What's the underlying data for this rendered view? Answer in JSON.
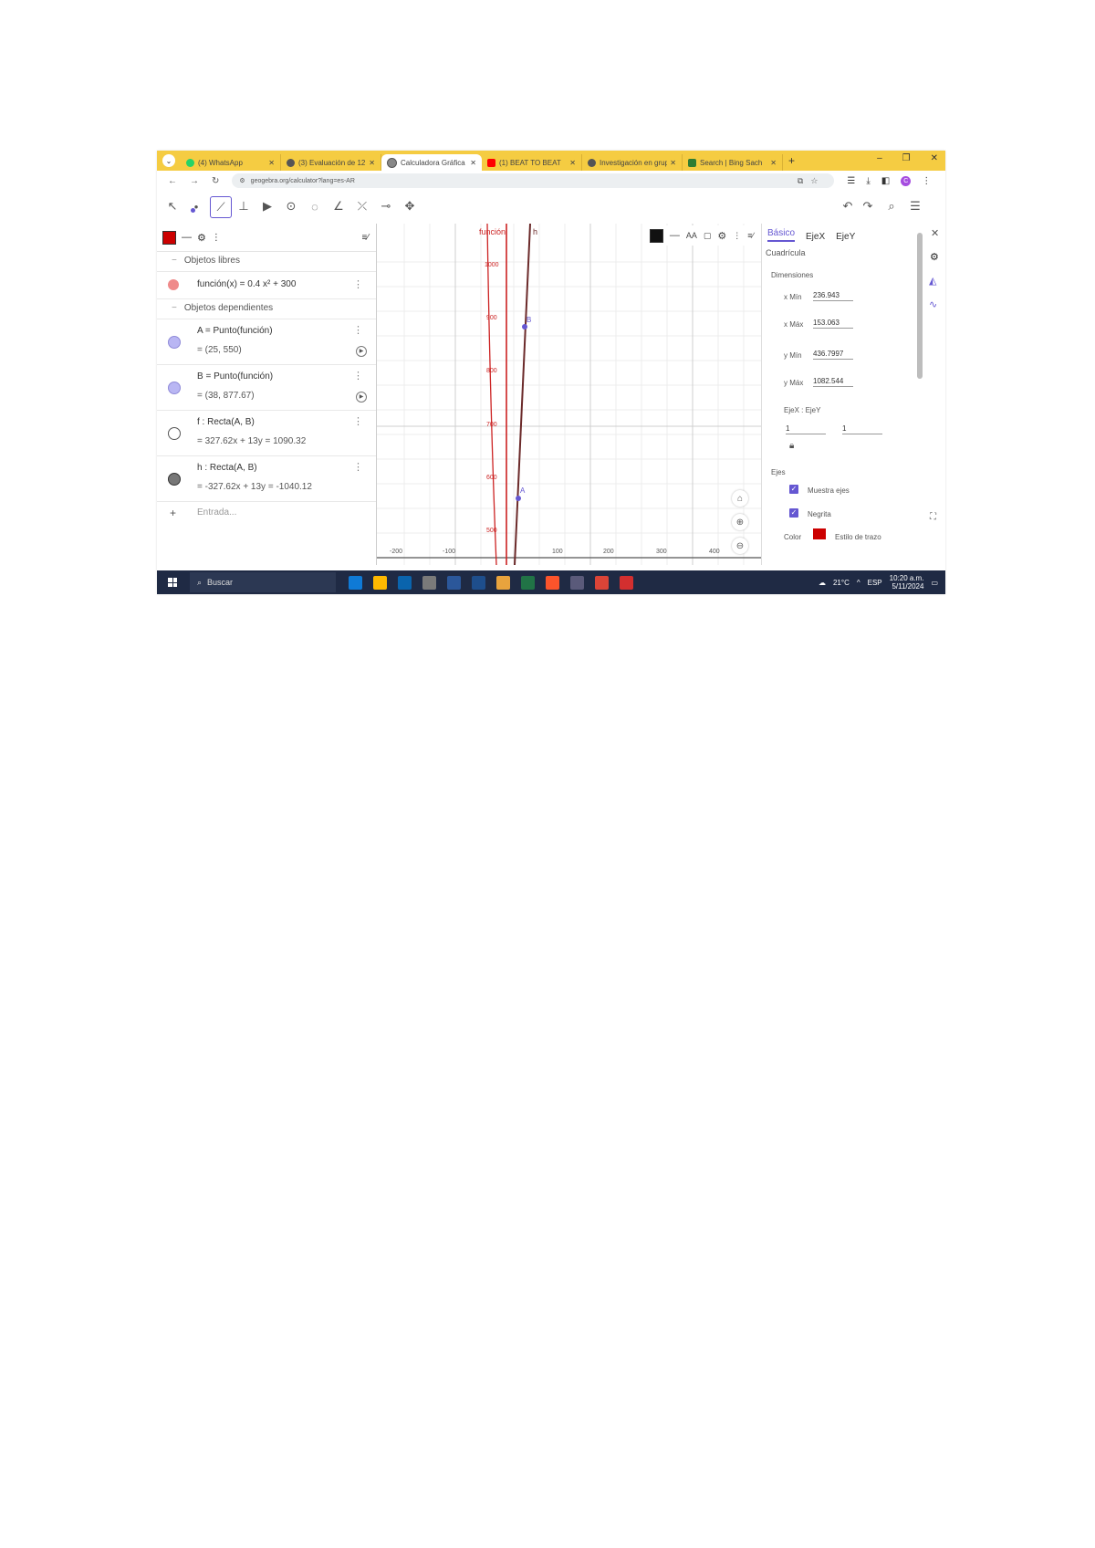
{
  "browser": {
    "tabs": [
      {
        "title": "(4) WhatsApp",
        "color": "#25d366"
      },
      {
        "title": "(3) Evaluación de 12",
        "color": "#555555"
      },
      {
        "title": "Calculadora Gráfica",
        "color": "#555555",
        "active": true
      },
      {
        "title": "(1) BEAT TO BEAT",
        "color": "#ff0000"
      },
      {
        "title": "Investigación en grupo",
        "color": "#555555"
      },
      {
        "title": "Search | Bing Sach",
        "color": "#2f7d32"
      }
    ],
    "new_tab": "+",
    "url": "geogebra.org/calculator?lang=es-AR",
    "window_controls": [
      "–",
      "❐",
      "✕"
    ],
    "profile_initial": "C"
  },
  "algebra": {
    "free_header": "Objetos libres",
    "dependent_header": "Objetos dependientes",
    "function_def": "función(x) = 0.4 x² + 300",
    "items": [
      {
        "def": "A = Punto(función)",
        "val": "= (25, 550)",
        "color": "#b9b6f3"
      },
      {
        "def": "B = Punto(función)",
        "val": "= (38, 877.67)",
        "color": "#b9b6f3"
      },
      {
        "def": "f : Recta(A, B)",
        "val": "= 327.62x + 13y = 1090.32",
        "color": "#ffffff"
      },
      {
        "def": "h : Recta(A, B)",
        "val": "= -327.62x + 13y = -1040.12",
        "color": "#777777"
      }
    ],
    "input_placeholder": "Entrada...",
    "function_color": "#ef8a8a"
  },
  "graph": {
    "label_function": "función",
    "label_h": "h",
    "point_a": "A",
    "point_b": "B",
    "y_ticks": [
      "1000",
      "900",
      "800",
      "700",
      "600",
      "500"
    ],
    "x_ticks": [
      "-200",
      "-100",
      "100",
      "200",
      "300",
      "400"
    ],
    "font_size_label": "AA"
  },
  "properties": {
    "tabs": [
      "Básico",
      "EjeX",
      "EjeY"
    ],
    "subtitle": "Cuadrícula",
    "section_dims": "Dimensiones",
    "xmin_label": "x Mín",
    "xmin": "236.943",
    "xmax_label": "x Máx",
    "xmax": "153.063",
    "ymin_label": "y Mín",
    "ymin": "436.7997",
    "ymax_label": "y Máx",
    "ymax": "1082.544",
    "ratio_label": "EjeX : EjeY",
    "ratio_x": "1",
    "ratio_y": "1",
    "axes_section": "Ejes",
    "show_axes": "Muestra ejes",
    "bold": "Negrita",
    "color_label": "Color",
    "line_style": "Estilo de trazo"
  },
  "taskbar": {
    "search": "Buscar",
    "weather": "21°C",
    "lang": "ESP",
    "time": "10:20 a.m.",
    "date": "5/11/2024"
  }
}
